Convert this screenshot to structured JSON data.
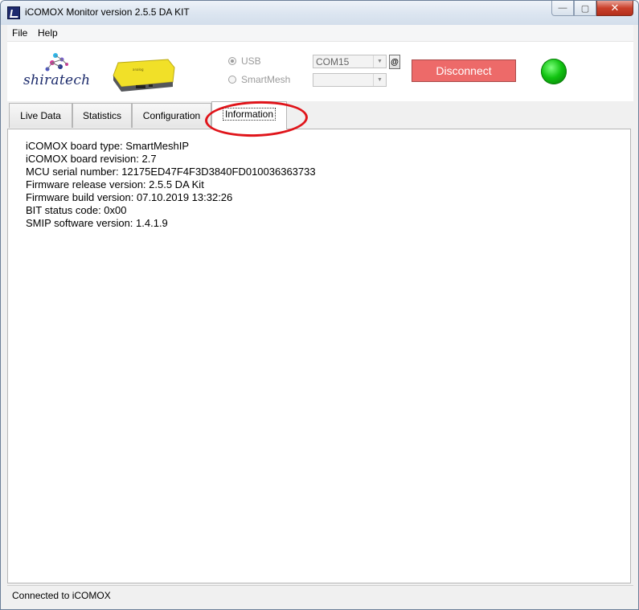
{
  "window": {
    "title": "iCOMOX Monitor version 2.5.5 DA KIT",
    "minimize_glyph": "—",
    "maximize_glyph": "▢",
    "close_glyph": "✕"
  },
  "menu": {
    "items": [
      {
        "label": "File"
      },
      {
        "label": "Help"
      }
    ]
  },
  "header": {
    "logo_text": "shiratech",
    "connection": {
      "usb_label": "USB",
      "smartmesh_label": "SmartMesh",
      "usb_selected": true,
      "com_port_value": "COM15",
      "mesh_port_value": "",
      "at_button_label": "@",
      "disconnect_label": "Disconnect",
      "status_led_color": "#11c311"
    }
  },
  "tabs": [
    {
      "label": "Live Data"
    },
    {
      "label": "Statistics"
    },
    {
      "label": "Configuration"
    },
    {
      "label": "Information",
      "active": true
    }
  ],
  "information": {
    "lines": [
      "iCOMOX board type: SmartMeshIP",
      "iCOMOX board revision: 2.7",
      "MCU serial number: 12175ED47F4F3D3840FD010036363733",
      "Firmware release version: 2.5.5 DA Kit",
      "Firmware build version: 07.10.2019 13:32:26",
      "BIT status code: 0x00",
      "SMIP software version: 1.4.1.9"
    ]
  },
  "status_bar": {
    "text": "Connected to iCOMOX"
  },
  "colors": {
    "disconnect_button": "#ed6a69",
    "highlight_circle": "#e0141a",
    "brand": "#1b2a6b"
  }
}
